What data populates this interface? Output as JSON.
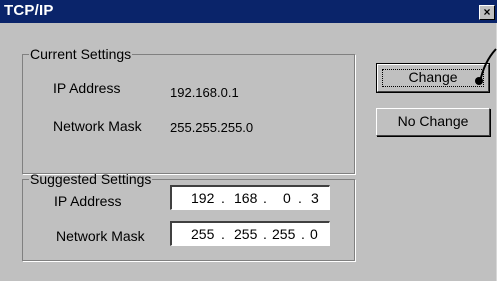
{
  "window": {
    "title": "TCP/IP",
    "close_glyph": "×"
  },
  "current": {
    "legend": "Current Settings",
    "ip_label": "IP Address",
    "ip_value": "192.168.0.1",
    "mask_label": "Network Mask",
    "mask_value": "255.255.255.0"
  },
  "suggested": {
    "legend": "Suggested Settings",
    "ip_label": "IP Address",
    "ip_octets": [
      "192",
      "168",
      "0",
      "3"
    ],
    "mask_label": "Network Mask",
    "mask_octets": [
      "255",
      "255",
      "255",
      "0"
    ]
  },
  "buttons": {
    "change": "Change",
    "no_change": "No Change"
  },
  "cursor": {
    "icon": "mouse-pointer-icon"
  },
  "colors": {
    "titlebar": "#0a246a",
    "face": "#c0c0c0"
  }
}
